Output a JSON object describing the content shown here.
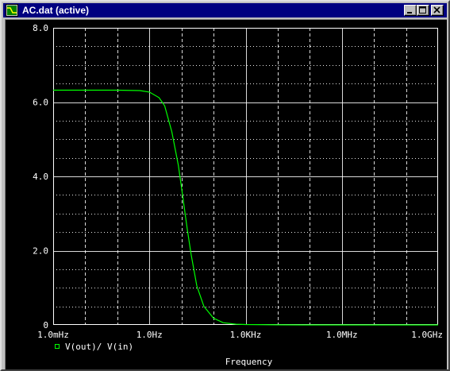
{
  "window": {
    "title": "AC.dat (active)",
    "icons": {
      "app": "probe-app-icon",
      "minimize": "minimize-icon",
      "maximize": "maximize-icon",
      "close": "close-icon"
    }
  },
  "colors": {
    "plot_background": "#000000",
    "trace": "#00ff00",
    "axis": "#ffffff",
    "grid": "#ffffff",
    "title_bar": "#000080"
  },
  "chart_data": {
    "type": "line",
    "xlabel": "Frequency",
    "ylabel": "",
    "x_scale": "log",
    "xlim": [
      0.001,
      1000000000
    ],
    "ylim": [
      0,
      8
    ],
    "x_ticks": [
      {
        "value": 0.001,
        "label": "1.0mHz"
      },
      {
        "value": 1,
        "label": "1.0Hz"
      },
      {
        "value": 1000,
        "label": "1.0KHz"
      },
      {
        "value": 1000000,
        "label": "1.0MHz"
      },
      {
        "value": 1000000000,
        "label": "1.0GHz"
      }
    ],
    "y_ticks": [
      {
        "value": 0,
        "label": "0"
      },
      {
        "value": 2,
        "label": "2.0"
      },
      {
        "value": 4,
        "label": "4.0"
      },
      {
        "value": 6,
        "label": "6.0"
      },
      {
        "value": 8,
        "label": "8.0"
      }
    ],
    "grid": true,
    "legend_position": "bottom-left",
    "series": [
      {
        "name": "V(out)/ V(in)",
        "color": "#00ff00",
        "x": [
          0.001,
          0.01,
          0.1,
          0.5,
          1,
          2,
          3,
          5,
          8,
          10,
          15,
          20,
          30,
          50,
          100,
          200,
          500,
          1000,
          10000,
          100000,
          1000000,
          10000000,
          100000000,
          1000000000
        ],
        "y": [
          6.32,
          6.32,
          6.32,
          6.31,
          6.27,
          6.12,
          5.9,
          5.2,
          4.3,
          3.7,
          2.6,
          1.9,
          1.05,
          0.5,
          0.18,
          0.06,
          0.02,
          0.01,
          0.002,
          0.0,
          0.0,
          0.0,
          0.0,
          0.0
        ]
      }
    ]
  }
}
